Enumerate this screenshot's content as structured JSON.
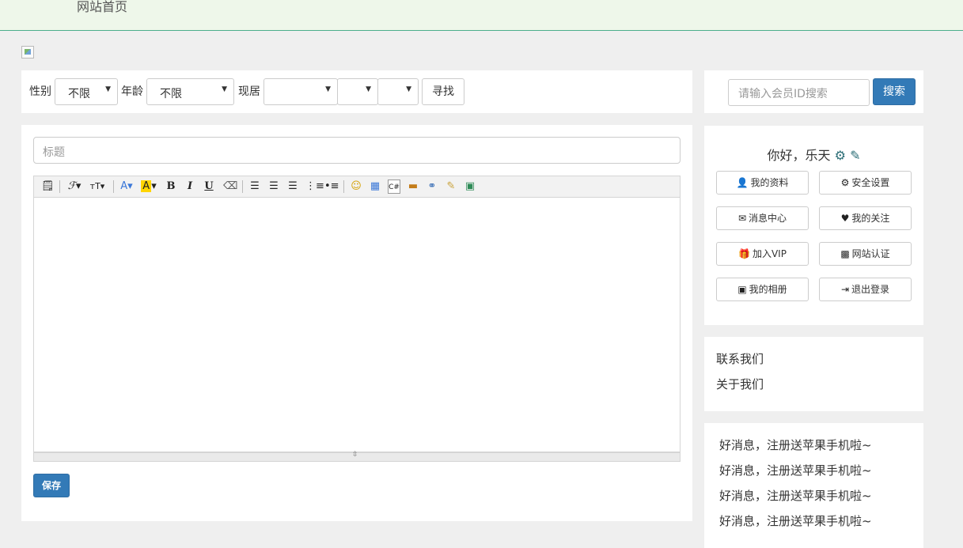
{
  "nav": {
    "home": "网站首页"
  },
  "filter": {
    "gender_label": "性别",
    "gender_value": "不限",
    "age_label": "年龄",
    "age_value": "不限",
    "residence_label": "现居",
    "residence_values": [
      "",
      "",
      ""
    ],
    "find_button": "寻找"
  },
  "search": {
    "placeholder": "请输入会员ID搜索",
    "button": "搜索"
  },
  "editor": {
    "title_placeholder": "标题",
    "toolbar": [
      "source-icon",
      "font-family-icon",
      "font-size-icon",
      "font-color-icon",
      "highlight-icon",
      "bold-icon",
      "italic-icon",
      "underline-icon",
      "eraser-icon",
      "align-left-icon",
      "align-center-icon",
      "align-right-icon",
      "ordered-list-icon",
      "unordered-list-icon",
      "emoticon-icon",
      "table-icon",
      "code-icon",
      "image-insert-icon",
      "link-icon",
      "pagebreak-icon",
      "picture-icon"
    ],
    "save_button": "保存"
  },
  "user": {
    "greeting": "你好，乐天",
    "buttons": [
      {
        "label": "我的资料",
        "icon": "user-icon"
      },
      {
        "label": "安全设置",
        "icon": "gear-icon"
      },
      {
        "label": "消息中心",
        "icon": "envelope-icon"
      },
      {
        "label": "我的关注",
        "icon": "heart-icon"
      },
      {
        "label": "加入VIP",
        "icon": "gift-icon"
      },
      {
        "label": "网站认证",
        "icon": "qrcode-icon"
      },
      {
        "label": "我的相册",
        "icon": "picture-icon"
      },
      {
        "label": "退出登录",
        "icon": "logout-icon"
      }
    ]
  },
  "links": {
    "contact": "联系我们",
    "about": "关于我们"
  },
  "news": {
    "items": [
      "好消息，注册送苹果手机啦~",
      "好消息，注册送苹果手机啦~",
      "好消息，注册送苹果手机啦~",
      "好消息，注册送苹果手机啦~"
    ]
  },
  "colors": {
    "primary": "#337ab7",
    "topbar_bg": "#eef7ea",
    "topbar_border": "#4cae8c",
    "icon_teal": "#2b6d76"
  }
}
